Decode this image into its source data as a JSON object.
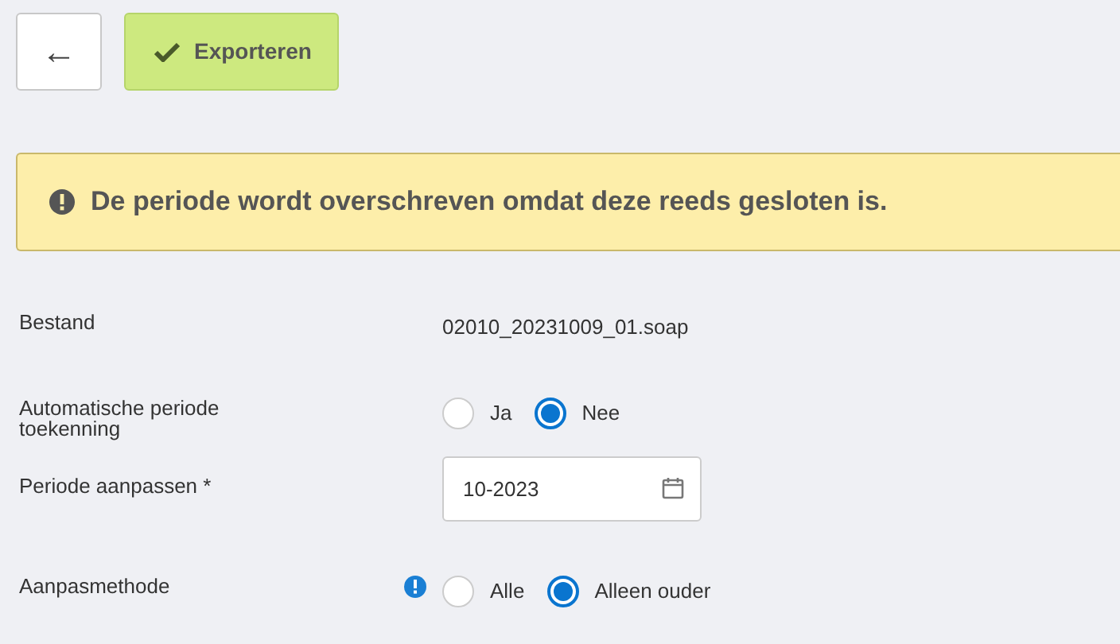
{
  "toolbar": {
    "back_button": {
      "label": "←"
    },
    "export_button": {
      "label": "Exporteren"
    }
  },
  "alert": {
    "message": "De periode wordt overschreven omdat deze reeds gesloten is."
  },
  "form": [
    {
      "kind": "text",
      "label": "Bestand",
      "value": "02010_20231009_01.soap"
    },
    {
      "kind": "radio",
      "label": "Automatische periode toekenning",
      "info": false,
      "options": [
        {
          "label": "Ja",
          "selected": false
        },
        {
          "label": "Nee",
          "selected": true
        }
      ]
    },
    {
      "kind": "date",
      "label": "Periode aanpassen *",
      "value": "10-2023"
    },
    {
      "kind": "radio",
      "label": "Aanpasmethode",
      "info": true,
      "options": [
        {
          "label": "Alle",
          "selected": false
        },
        {
          "label": "Alleen ouder",
          "selected": true
        }
      ]
    }
  ]
}
